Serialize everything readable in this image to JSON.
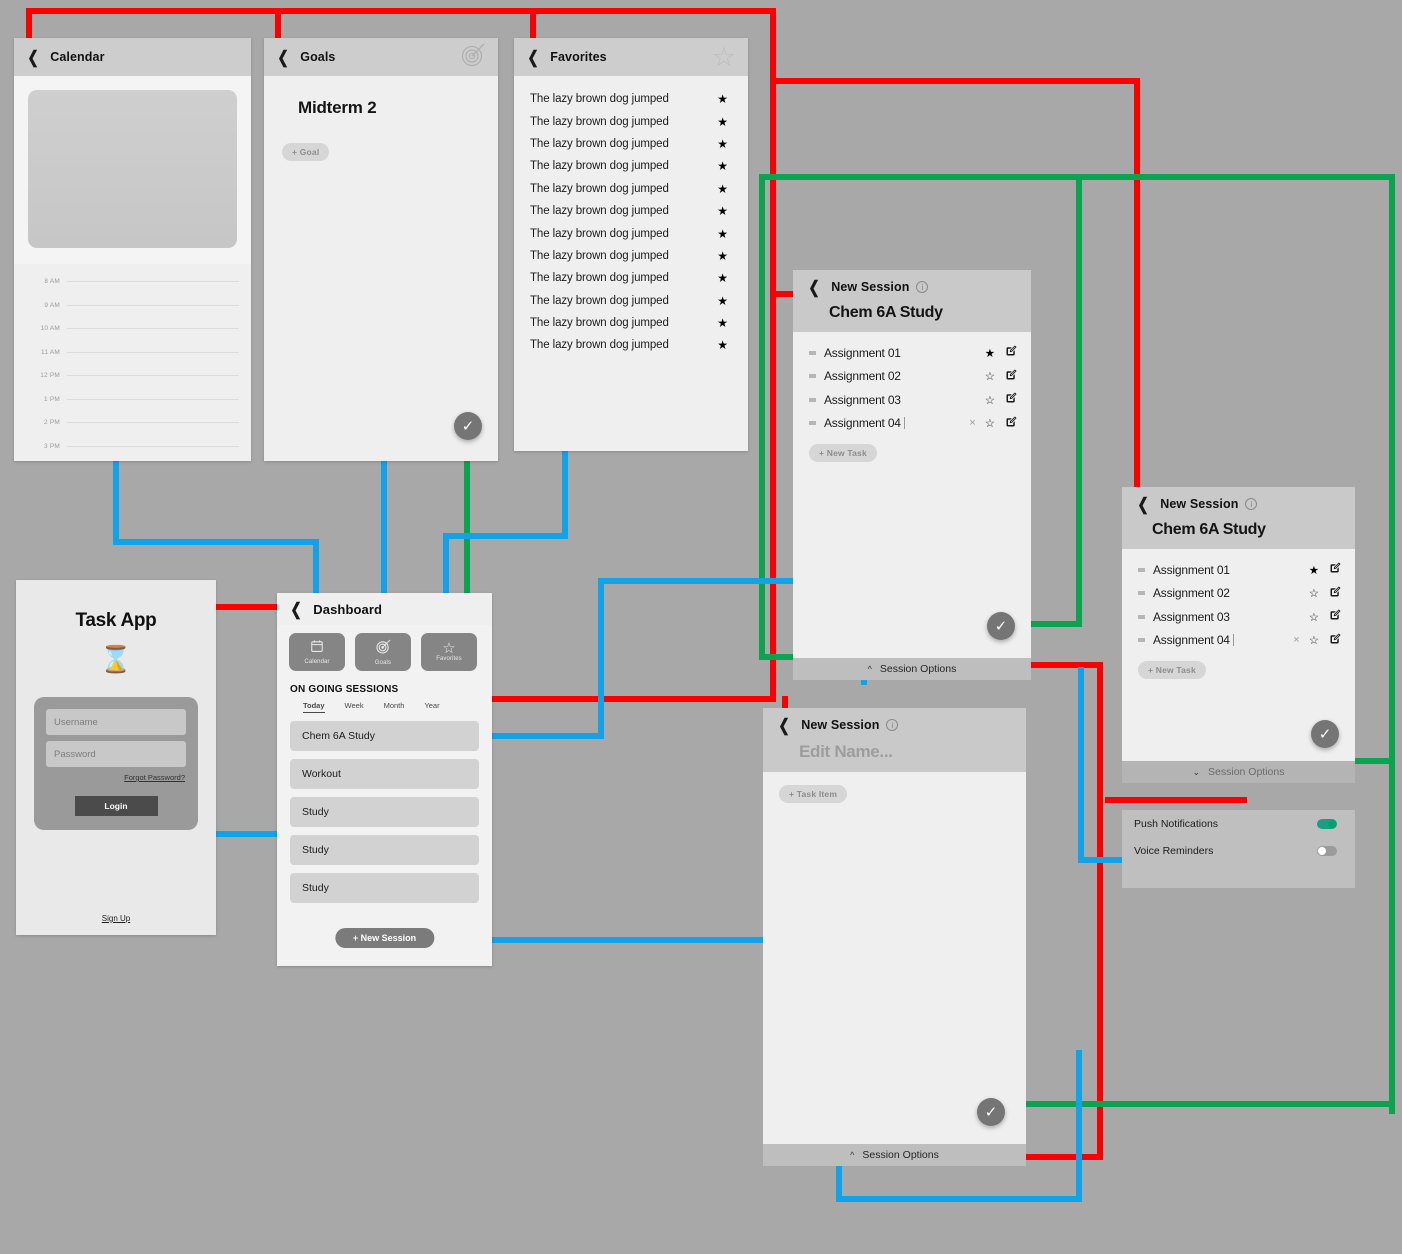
{
  "colors": {
    "red": "#fb0000",
    "blue": "#11a2e8",
    "green": "#0aa34f",
    "canvas": "#a8a8a8",
    "toggle_on": "#18a085"
  },
  "calendar": {
    "back_icon": "chevron-left-icon",
    "title": "Calendar",
    "times": [
      "8 AM",
      "9 AM",
      "10 AM",
      "11 AM",
      "12 PM",
      "1 PM",
      "2 PM",
      "3 PM"
    ]
  },
  "goals": {
    "back_icon": "chevron-left-icon",
    "title": "Goals",
    "header_icon": "target-icon",
    "heading": "Midterm 2",
    "add_goal_label": "+ Goal",
    "fab_icon": "check-icon"
  },
  "favorites": {
    "back_icon": "chevron-left-icon",
    "title": "Favorites",
    "header_icon": "star-outline-icon",
    "items": [
      {
        "text": "The lazy brown dog jumped",
        "starred": true
      },
      {
        "text": "The lazy brown dog jumped",
        "starred": true
      },
      {
        "text": "The lazy brown dog jumped",
        "starred": true
      },
      {
        "text": "The lazy brown dog jumped",
        "starred": true
      },
      {
        "text": "The lazy brown dog jumped",
        "starred": true
      },
      {
        "text": "The lazy brown dog jumped",
        "starred": true
      },
      {
        "text": "The lazy brown dog jumped",
        "starred": true
      },
      {
        "text": "The lazy brown dog jumped",
        "starred": true
      },
      {
        "text": "The lazy brown dog jumped",
        "starred": true
      },
      {
        "text": "The lazy brown dog jumped",
        "starred": true
      },
      {
        "text": "The lazy brown dog jumped",
        "starred": true
      },
      {
        "text": "The lazy brown dog jumped",
        "starred": true
      }
    ]
  },
  "login": {
    "app_title": "Task App",
    "logo_icon": "hourglass-icon",
    "username_placeholder": "Username",
    "password_placeholder": "Password",
    "forgot_label": "Forgot Password?",
    "login_label": "Login",
    "signup_label": "Sign Up"
  },
  "dashboard": {
    "back_icon": "chevron-left-icon",
    "title": "Dashboard",
    "shortcuts": [
      {
        "label": "Calendar",
        "icon": "calendar-icon"
      },
      {
        "label": "Goals",
        "icon": "target-icon"
      },
      {
        "label": "Favorites",
        "icon": "star-icon"
      }
    ],
    "section_title": "ON GOING SESSIONS",
    "tabs": [
      {
        "label": "Today",
        "active": true
      },
      {
        "label": "Week",
        "active": false
      },
      {
        "label": "Month",
        "active": false
      },
      {
        "label": "Year",
        "active": false
      }
    ],
    "sessions": [
      "Chem 6A Study",
      "Workout",
      "Study",
      "Study",
      "Study"
    ],
    "new_session_label": "+  New Session"
  },
  "session_filled": {
    "back_icon": "chevron-left-icon",
    "bar_title": "New Session",
    "info_icon": "info-icon",
    "name": "Chem 6A Study",
    "tasks": [
      {
        "label": "Assignment 01",
        "starred": true,
        "editing": false
      },
      {
        "label": "Assignment 02",
        "starred": false,
        "editing": false
      },
      {
        "label": "Assignment 03",
        "starred": false,
        "editing": false
      },
      {
        "label": "Assignment 04",
        "starred": false,
        "editing": true
      }
    ],
    "new_task_label": "+ New Task",
    "confirm_icon": "check-icon",
    "session_options_label": "Session Options",
    "session_options_chevron": "chevron-up-icon"
  },
  "session_empty": {
    "back_icon": "chevron-left-icon",
    "bar_title": "New Session",
    "info_icon": "info-icon",
    "name_placeholder": "Edit Name...",
    "add_task_label": "+ Task Item",
    "confirm_icon": "check-icon",
    "session_options_label": "Session Options",
    "session_options_chevron": "chevron-up-icon"
  },
  "session_options_panel": {
    "back_icon": "chevron-left-icon",
    "bar_title": "New Session",
    "info_icon": "info-icon",
    "name": "Chem 6A Study",
    "tasks": [
      {
        "label": "Assignment 01",
        "starred": true,
        "editing": false
      },
      {
        "label": "Assignment 02",
        "starred": false,
        "editing": false
      },
      {
        "label": "Assignment 03",
        "starred": false,
        "editing": false
      },
      {
        "label": "Assignment 04",
        "starred": false,
        "editing": true
      }
    ],
    "new_task_label": "+ New Task",
    "confirm_icon": "check-icon",
    "session_options_label": "Session Options",
    "session_options_chevron": "chevron-down-icon",
    "options": [
      {
        "label": "Push Notifications",
        "enabled": true
      },
      {
        "label": "Voice Reminders",
        "enabled": false
      }
    ]
  }
}
